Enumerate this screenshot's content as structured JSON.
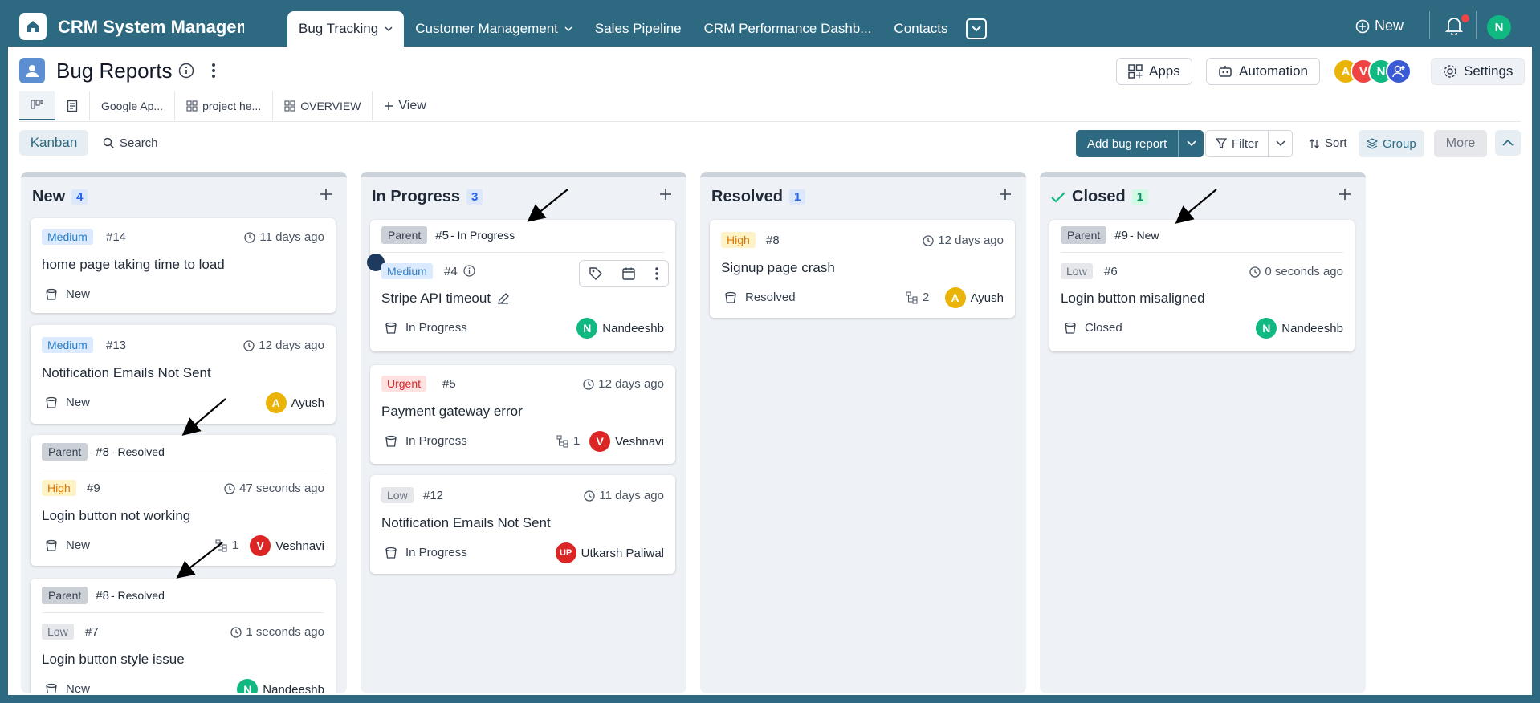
{
  "top": {
    "app_title": "CRM System Management",
    "tabs": [
      {
        "label": "Bug Tracking",
        "active": true,
        "dropdown": true
      },
      {
        "label": "Customer Management",
        "dropdown": true
      },
      {
        "label": "Sales Pipeline"
      },
      {
        "label": "CRM Performance Dashb..."
      },
      {
        "label": "Contacts"
      }
    ],
    "new_label": "New",
    "user_initial": "N"
  },
  "header": {
    "title": "Bug Reports",
    "apps_label": "Apps",
    "automation_label": "Automation",
    "settings_label": "Settings",
    "members": [
      {
        "initial": "A",
        "color": "#eab308"
      },
      {
        "initial": "V",
        "color": "#ef4444"
      },
      {
        "initial": "N",
        "color": "#10b981"
      }
    ]
  },
  "views": [
    {
      "label": "",
      "icon": "kanban-view-icon"
    },
    {
      "label": "",
      "icon": "document-icon"
    },
    {
      "label": "Google Ap...",
      "icon": ""
    },
    {
      "label": "project he...",
      "icon": "dashboard-icon"
    },
    {
      "label": "OVERVIEW",
      "icon": "dashboard-icon"
    },
    {
      "label": "View",
      "icon": "plus-icon"
    }
  ],
  "toolbar": {
    "kanban": "Kanban",
    "search": "Search",
    "add_bug": "Add bug report",
    "filter": "Filter",
    "sort": "Sort",
    "group": "Group",
    "more": "More"
  },
  "columns": [
    {
      "title": "New",
      "count": "4",
      "cards": [
        {
          "priority": "Medium",
          "num": "#14",
          "time": "11 days ago",
          "title": "home page taking time to load",
          "status": "New"
        },
        {
          "priority": "Medium",
          "num": "#13",
          "time": "12 days ago",
          "title": "Notification Emails Not Sent",
          "status": "New",
          "assignee": "Ayush",
          "initial": "A"
        },
        {
          "parent_label": "Parent",
          "parent": "#8",
          "parent_status": "- Resolved",
          "priority": "High",
          "num": "#9",
          "time": "47 seconds ago",
          "title": "Login button not working",
          "status": "New",
          "sub": "1",
          "assignee": "Veshnavi",
          "initial": "V"
        },
        {
          "parent_label": "Parent",
          "parent": "#8",
          "parent_status": "- Resolved",
          "priority": "Low",
          "num": "#7",
          "time": "1 seconds ago",
          "title": "Login button style issue",
          "status": "New",
          "assignee": "Nandeeshb",
          "initial": "N"
        }
      ]
    },
    {
      "title": "In Progress",
      "count": "3",
      "cards": [
        {
          "parent_label": "Parent",
          "parent": "#5",
          "parent_status": "- In Progress",
          "priority": "Medium",
          "num": "#4",
          "title": "Stripe API timeout",
          "status": "In Progress",
          "assignee": "Nandeeshb",
          "initial": "N"
        },
        {
          "priority": "Urgent",
          "num": "#5",
          "time": "12 days ago",
          "title": "Payment gateway error",
          "status": "In Progress",
          "sub": "1",
          "assignee": "Veshnavi",
          "initial": "V"
        },
        {
          "priority": "Low",
          "num": "#12",
          "time": "11 days ago",
          "title": "Notification Emails Not Sent",
          "status": "In Progress",
          "assignee": "Utkarsh Paliwal",
          "initial": "UP"
        }
      ]
    },
    {
      "title": "Resolved",
      "count": "1",
      "cards": [
        {
          "priority": "High",
          "num": "#8",
          "time": "12 days ago",
          "title": "Signup page crash",
          "status": "Resolved",
          "sub": "2",
          "assignee": "Ayush",
          "initial": "A"
        }
      ]
    },
    {
      "title": "Closed",
      "count": "1",
      "cards": [
        {
          "parent_label": "Parent",
          "parent": "#9",
          "parent_status": "- New",
          "priority": "Low",
          "num": "#6",
          "time": "0 seconds ago",
          "title": "Login button misaligned",
          "status": "Closed",
          "assignee": "Nandeeshb",
          "initial": "N"
        }
      ]
    }
  ]
}
